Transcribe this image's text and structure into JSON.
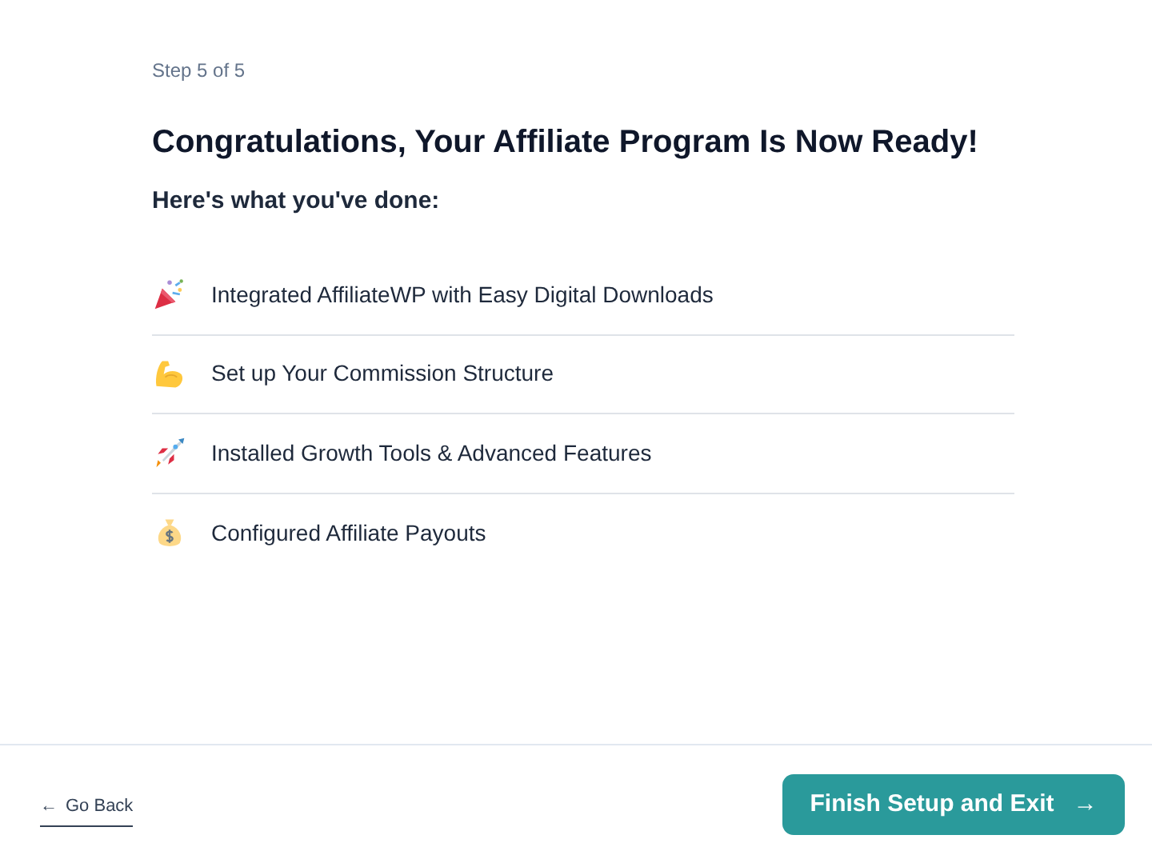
{
  "step": "Step 5 of 5",
  "title": "Congratulations, Your Affiliate Program Is Now Ready!",
  "subtitle": "Here's what you've done:",
  "items": [
    {
      "label": "Integrated AffiliateWP with Easy Digital Downloads"
    },
    {
      "label": "Set up Your Commission Structure"
    },
    {
      "label": "Installed Growth Tools & Advanced Features"
    },
    {
      "label": "Configured Affiliate Payouts"
    }
  ],
  "back_link": {
    "arrow": "←",
    "label": "Go Back"
  },
  "finish_button": {
    "label": "Finish Setup and Exit",
    "arrow": "→"
  }
}
